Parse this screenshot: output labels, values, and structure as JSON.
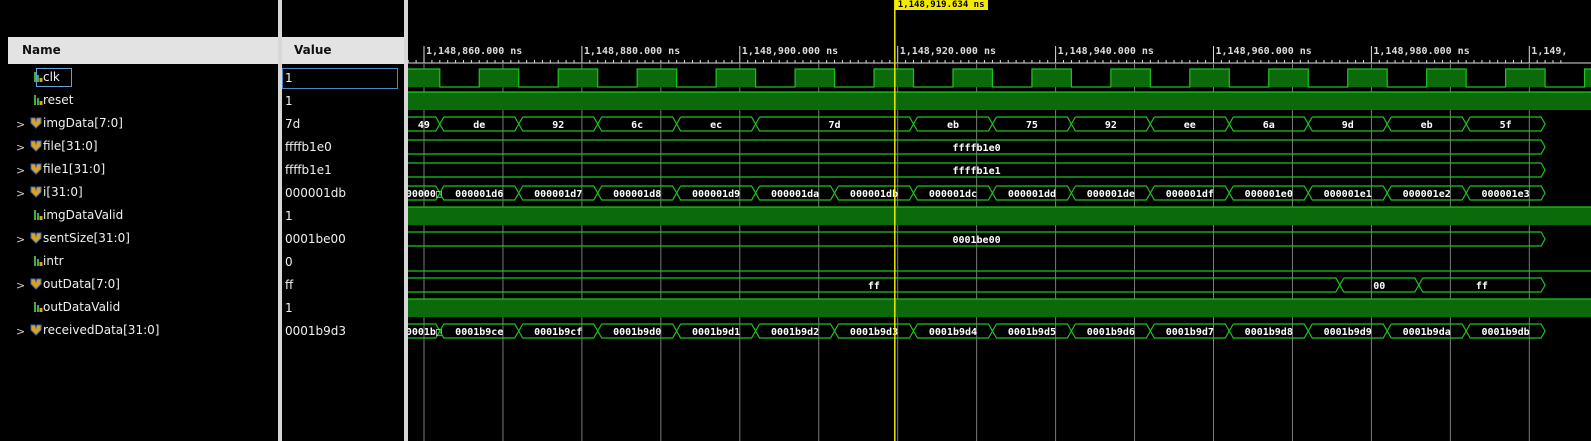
{
  "columns": {
    "name": "Name",
    "value": "Value"
  },
  "marker": {
    "label": "1,148,919.634 ns",
    "time": 1148919.634
  },
  "timeline": {
    "ticks": [
      {
        "t": 1148860,
        "label": "1,148,860.000 ns"
      },
      {
        "t": 1148880,
        "label": "1,148,880.000 ns"
      },
      {
        "t": 1148900,
        "label": "1,148,900.000 ns"
      },
      {
        "t": 1148920,
        "label": "1,148,920.000 ns"
      },
      {
        "t": 1148940,
        "label": "1,148,940.000 ns"
      },
      {
        "t": 1148960,
        "label": "1,148,960.000 ns"
      },
      {
        "t": 1148980,
        "label": "1,148,980.000 ns"
      },
      {
        "t": 1149000,
        "label": "1,149,"
      }
    ]
  },
  "signals": [
    {
      "name": "clk",
      "value": "1",
      "type": "bit",
      "expandable": false,
      "selected": true,
      "wave": {
        "kind": "clock",
        "start_level": 1,
        "first_edge": 1148862,
        "half_period": 5
      }
    },
    {
      "name": "reset",
      "value": "1",
      "type": "bit",
      "expandable": false,
      "wave": {
        "kind": "bit",
        "start_level": 1,
        "edges": []
      }
    },
    {
      "name": "imgData[7:0]",
      "value": "7d",
      "type": "bus",
      "expandable": true,
      "wave": {
        "kind": "bus",
        "segments": [
          {
            "start": 1148856,
            "end": 1148862,
            "text": "49"
          },
          {
            "start": 1148862,
            "end": 1148872,
            "text": "de"
          },
          {
            "start": 1148872,
            "end": 1148882,
            "text": "92"
          },
          {
            "start": 1148882,
            "end": 1148892,
            "text": "6c"
          },
          {
            "start": 1148892,
            "end": 1148902,
            "text": "ec"
          },
          {
            "start": 1148902,
            "end": 1148922,
            "text": "7d"
          },
          {
            "start": 1148922,
            "end": 1148932,
            "text": "eb"
          },
          {
            "start": 1148932,
            "end": 1148942,
            "text": "75"
          },
          {
            "start": 1148942,
            "end": 1148952,
            "text": "92"
          },
          {
            "start": 1148952,
            "end": 1148962,
            "text": "ee"
          },
          {
            "start": 1148962,
            "end": 1148972,
            "text": "6a"
          },
          {
            "start": 1148972,
            "end": 1148982,
            "text": "9d"
          },
          {
            "start": 1148982,
            "end": 1148992,
            "text": "eb"
          },
          {
            "start": 1148992,
            "end": 1149002,
            "text": "5f"
          }
        ]
      }
    },
    {
      "name": "file[31:0]",
      "value": "ffffb1e0",
      "type": "bus",
      "expandable": true,
      "wave": {
        "kind": "bus",
        "segments": [
          {
            "start": 1148856,
            "end": 1149002,
            "text": "ffffb1e0"
          }
        ]
      }
    },
    {
      "name": "file1[31:0]",
      "value": "ffffb1e1",
      "type": "bus",
      "expandable": true,
      "wave": {
        "kind": "bus",
        "segments": [
          {
            "start": 1148856,
            "end": 1149002,
            "text": "ffffb1e1"
          }
        ]
      }
    },
    {
      "name": "i[31:0]",
      "value": "000001db",
      "type": "bus",
      "expandable": true,
      "wave": {
        "kind": "bus",
        "segments": [
          {
            "start": 1148856,
            "end": 1148862,
            "text": "00000□"
          },
          {
            "start": 1148862,
            "end": 1148872,
            "text": "000001d6"
          },
          {
            "start": 1148872,
            "end": 1148882,
            "text": "000001d7"
          },
          {
            "start": 1148882,
            "end": 1148892,
            "text": "000001d8"
          },
          {
            "start": 1148892,
            "end": 1148902,
            "text": "000001d9"
          },
          {
            "start": 1148902,
            "end": 1148912,
            "text": "000001da"
          },
          {
            "start": 1148912,
            "end": 1148922,
            "text": "000001db"
          },
          {
            "start": 1148922,
            "end": 1148932,
            "text": "000001dc"
          },
          {
            "start": 1148932,
            "end": 1148942,
            "text": "000001dd"
          },
          {
            "start": 1148942,
            "end": 1148952,
            "text": "000001de"
          },
          {
            "start": 1148952,
            "end": 1148962,
            "text": "000001df"
          },
          {
            "start": 1148962,
            "end": 1148972,
            "text": "000001e0"
          },
          {
            "start": 1148972,
            "end": 1148982,
            "text": "000001e1"
          },
          {
            "start": 1148982,
            "end": 1148992,
            "text": "000001e2"
          },
          {
            "start": 1148992,
            "end": 1149002,
            "text": "000001e3"
          }
        ]
      }
    },
    {
      "name": "imgDataValid",
      "value": "1",
      "type": "bit",
      "expandable": false,
      "wave": {
        "kind": "bit",
        "start_level": 1,
        "edges": []
      }
    },
    {
      "name": "sentSize[31:0]",
      "value": "0001be00",
      "type": "bus",
      "expandable": true,
      "wave": {
        "kind": "bus",
        "segments": [
          {
            "start": 1148856,
            "end": 1149002,
            "text": "0001be00"
          }
        ]
      }
    },
    {
      "name": "intr",
      "value": "0",
      "type": "bit",
      "expandable": false,
      "wave": {
        "kind": "bit",
        "start_level": 0,
        "edges": []
      }
    },
    {
      "name": "outData[7:0]",
      "value": "ff",
      "type": "bus",
      "expandable": true,
      "wave": {
        "kind": "bus",
        "segments": [
          {
            "start": 1148856,
            "end": 1148976,
            "text": "ff"
          },
          {
            "start": 1148976,
            "end": 1148986,
            "text": "00"
          },
          {
            "start": 1148986,
            "end": 1149002,
            "text": "ff"
          }
        ]
      }
    },
    {
      "name": "outDataValid",
      "value": "1",
      "type": "bit",
      "expandable": false,
      "wave": {
        "kind": "bit",
        "start_level": 1,
        "edges": []
      }
    },
    {
      "name": "receivedData[31:0]",
      "value": "0001b9d3",
      "type": "bus",
      "expandable": true,
      "wave": {
        "kind": "bus",
        "segments": [
          {
            "start": 1148856,
            "end": 1148862,
            "text": "0001b□"
          },
          {
            "start": 1148862,
            "end": 1148872,
            "text": "0001b9ce"
          },
          {
            "start": 1148872,
            "end": 1148882,
            "text": "0001b9cf"
          },
          {
            "start": 1148882,
            "end": 1148892,
            "text": "0001b9d0"
          },
          {
            "start": 1148892,
            "end": 1148902,
            "text": "0001b9d1"
          },
          {
            "start": 1148902,
            "end": 1148912,
            "text": "0001b9d2"
          },
          {
            "start": 1148912,
            "end": 1148922,
            "text": "0001b9d3"
          },
          {
            "start": 1148922,
            "end": 1148932,
            "text": "0001b9d4"
          },
          {
            "start": 1148932,
            "end": 1148942,
            "text": "0001b9d5"
          },
          {
            "start": 1148942,
            "end": 1148952,
            "text": "0001b9d6"
          },
          {
            "start": 1148952,
            "end": 1148962,
            "text": "0001b9d7"
          },
          {
            "start": 1148962,
            "end": 1148972,
            "text": "0001b9d8"
          },
          {
            "start": 1148972,
            "end": 1148982,
            "text": "0001b9d9"
          },
          {
            "start": 1148982,
            "end": 1148992,
            "text": "0001b9da"
          },
          {
            "start": 1148992,
            "end": 1149002,
            "text": "0001b9db"
          }
        ]
      }
    }
  ],
  "colors": {
    "background": "#000000",
    "wave_line": "#1ec41e",
    "wave_fill": "#0b6b0b",
    "grid": "#7a7a7a",
    "marker": "#f2ea00",
    "ruler": "#dcdcdc",
    "bus_text": "#ffffff"
  },
  "icons": {
    "bit": "bit-signal-icon",
    "bus": "bus-signal-icon",
    "expand": "chevron-right-icon"
  }
}
